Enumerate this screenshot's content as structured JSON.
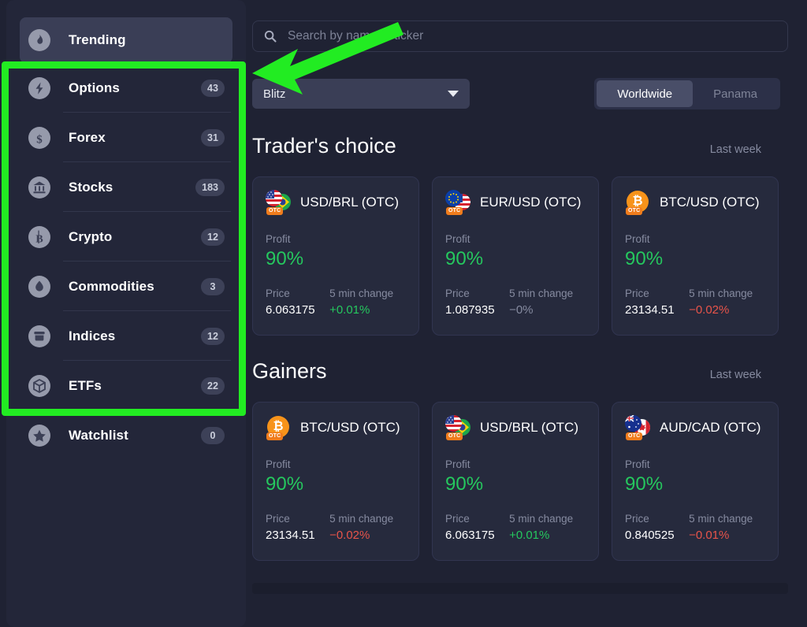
{
  "sidebar": {
    "items": [
      {
        "label": "Trending",
        "badge": "",
        "icon": "flame-icon",
        "selected": true,
        "divider": false
      },
      {
        "label": "Options",
        "badge": "43",
        "icon": "bolt-icon",
        "selected": false,
        "divider": true
      },
      {
        "label": "Forex",
        "badge": "31",
        "icon": "dollar-icon",
        "selected": false,
        "divider": true
      },
      {
        "label": "Stocks",
        "badge": "183",
        "icon": "bank-icon",
        "selected": false,
        "divider": true
      },
      {
        "label": "Crypto",
        "badge": "12",
        "icon": "bitcoin-icon",
        "selected": false,
        "divider": true
      },
      {
        "label": "Commodities",
        "badge": "3",
        "icon": "droplet-icon",
        "selected": false,
        "divider": true
      },
      {
        "label": "Indices",
        "badge": "12",
        "icon": "archive-icon",
        "selected": false,
        "divider": true
      },
      {
        "label": "ETFs",
        "badge": "22",
        "icon": "cube-icon",
        "selected": false,
        "divider": false
      },
      {
        "label": "Watchlist",
        "badge": "0",
        "icon": "star-icon",
        "selected": false,
        "divider": false
      }
    ]
  },
  "search": {
    "placeholder": "Search by name or ticker",
    "value": "",
    "icon": "search-icon"
  },
  "filter": {
    "selected": "Blitz",
    "caret": "chevron-down-icon"
  },
  "region_toggle": {
    "options": [
      "Worldwide",
      "Panama"
    ],
    "active": "Worldwide"
  },
  "sections": [
    {
      "title": "Trader's choice",
      "subtitle": "Last week",
      "cards": [
        {
          "name": "USD/BRL (OTC)",
          "icon": "usd-brl-flag-icon",
          "flag_front": "us",
          "flag_back": "br",
          "profit_label": "Profit",
          "profit": "90%",
          "price_label": "Price",
          "price": "6.063175",
          "change_label": "5 min change",
          "change": "+0.01%",
          "change_dir": "up"
        },
        {
          "name": "EUR/USD (OTC)",
          "icon": "eur-usd-flag-icon",
          "flag_front": "eu",
          "flag_back": "us",
          "profit_label": "Profit",
          "profit": "90%",
          "price_label": "Price",
          "price": "1.087935",
          "change_label": "5 min change",
          "change": "−0%",
          "change_dir": "neutral"
        },
        {
          "name": "BTC/USD (OTC)",
          "icon": "btc-usd-crypto-icon",
          "flag_front": "btc",
          "flag_back": "",
          "profit_label": "Profit",
          "profit": "90%",
          "price_label": "Price",
          "price": "23134.51",
          "change_label": "5 min change",
          "change": "−0.02%",
          "change_dir": "down"
        }
      ]
    },
    {
      "title": "Gainers",
      "subtitle": "Last week",
      "cards": [
        {
          "name": "BTC/USD (OTC)",
          "icon": "btc-usd-crypto-icon",
          "flag_front": "btc",
          "flag_back": "",
          "profit_label": "Profit",
          "profit": "90%",
          "price_label": "Price",
          "price": "23134.51",
          "change_label": "5 min change",
          "change": "−0.02%",
          "change_dir": "down"
        },
        {
          "name": "USD/BRL (OTC)",
          "icon": "usd-brl-flag-icon",
          "flag_front": "us",
          "flag_back": "br",
          "profit_label": "Profit",
          "profit": "90%",
          "price_label": "Price",
          "price": "6.063175",
          "change_label": "5 min change",
          "change": "+0.01%",
          "change_dir": "up"
        },
        {
          "name": "AUD/CAD (OTC)",
          "icon": "aud-cad-flag-icon",
          "flag_front": "au",
          "flag_back": "ca",
          "profit_label": "Profit",
          "profit": "90%",
          "price_label": "Price",
          "price": "0.840525",
          "change_label": "5 min change",
          "change": "−0.01%",
          "change_dir": "down"
        }
      ]
    }
  ],
  "annotations": {
    "highlight_color": "#22ec22",
    "box_target": "asset-category-list",
    "arrow_target": "asset-category-list"
  },
  "colors": {
    "background": "#1f2233",
    "panel": "#232639",
    "card": "#262a3d",
    "accent_green": "#25c85e",
    "accent_red": "#e8544a",
    "text_muted": "#868ba0"
  }
}
